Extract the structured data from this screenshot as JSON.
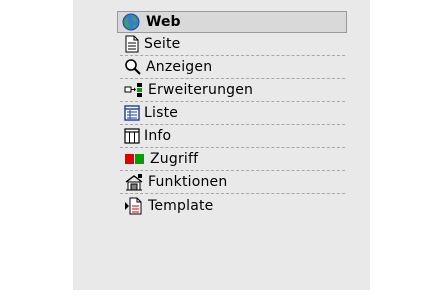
{
  "menu": {
    "title": "Web",
    "items": [
      {
        "label": "Seite",
        "icon": "page-icon"
      },
      {
        "label": "Anzeigen",
        "icon": "magnifier-icon"
      },
      {
        "label": "Erweiterungen",
        "icon": "extension-tree-icon"
      },
      {
        "label": "Liste",
        "icon": "list-icon"
      },
      {
        "label": "Info",
        "icon": "info-columns-icon"
      },
      {
        "label": "Zugriff",
        "icon": "access-icon"
      },
      {
        "label": "Funktionen",
        "icon": "functions-icon"
      },
      {
        "label": "Template",
        "icon": "template-icon"
      }
    ]
  },
  "colors": {
    "panel_background": "#e9e9e9",
    "header_background": "#d9d9d9",
    "divider": "#a8a8a8",
    "access_red": "#e00000",
    "access_green": "#00a000"
  }
}
